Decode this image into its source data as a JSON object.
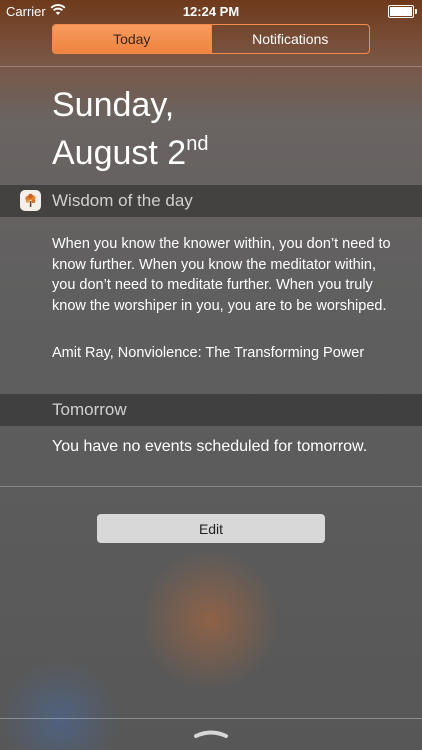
{
  "status_bar": {
    "carrier": "Carrier",
    "time": "12:24 PM",
    "wifi_icon": "wifi-icon",
    "battery_icon": "battery-icon"
  },
  "tabs": [
    {
      "label": "Today",
      "selected": true
    },
    {
      "label": "Notifications",
      "selected": false
    }
  ],
  "date": {
    "line1": "Sunday,",
    "line2": "August 2",
    "suffix": "nd"
  },
  "wisdom": {
    "icon": "tree-icon",
    "title": "Wisdom of the day",
    "quote": "When you know the knower within, you don’t need to know further. When you know the meditator within, you don’t need to meditate further. When you truly know the worshiper in you, you are to be worshiped.",
    "author": "Amit Ray, Nonviolence: The Transforming Power"
  },
  "tomorrow": {
    "title": "Tomorrow",
    "message": "You have no events scheduled for tomorrow."
  },
  "edit_label": "Edit",
  "colors": {
    "accent": "#f0843f",
    "text": "#ffffff"
  }
}
